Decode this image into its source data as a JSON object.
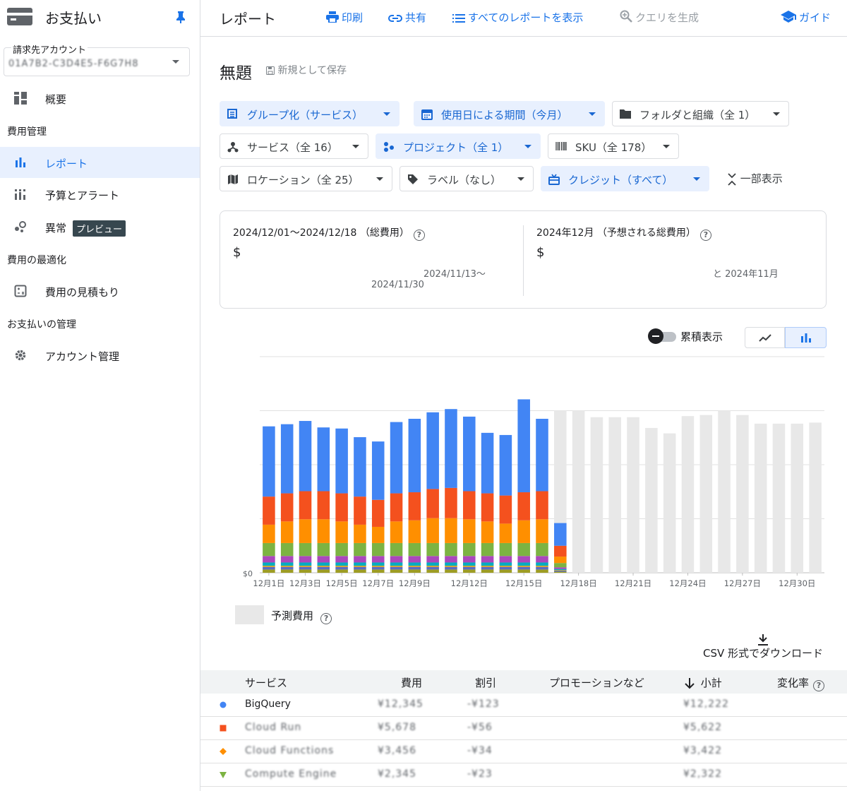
{
  "sidebar": {
    "app_title": "お支払い",
    "account_label": "請求先アカウント",
    "account_value": "01A7B2-C3D4E5-F6G7H8",
    "overview": "概要",
    "section_cost": "費用管理",
    "reports": "レポート",
    "budgets": "予算とアラート",
    "anomalies": "異常",
    "preview_badge": "プレビュー",
    "section_optimize": "費用の最適化",
    "estimate": "費用の見積もり",
    "section_manage": "お支払いの管理",
    "account_mgmt": "アカウント管理"
  },
  "topbar": {
    "title": "レポート",
    "print": "印刷",
    "share": "共有",
    "all_reports": "すべてのレポートを表示",
    "generate_query": "クエリを生成",
    "guide": "ガイド"
  },
  "report": {
    "title": "無題",
    "save_new": "新規として保存"
  },
  "filters": {
    "group": "グループ化（サービス）",
    "period": "使用日による期間（今月）",
    "folder": "フォルダと組織（全 1）",
    "service": "サービス（全 16）",
    "project": "プロジェクト（全 1）",
    "sku": "SKU（全 178）",
    "location": "ロケーション（全 25）",
    "label": "ラベル（なし）",
    "credit": "クレジット（すべて）",
    "collapse": "一部表示"
  },
  "summary": {
    "left_label": "2024/12/01〜2024/12/18 （総費用）",
    "left_value": "$",
    "left_compare_1": "2024/11/13〜",
    "left_compare_2": "2024/11/30",
    "right_label": "2024年12月 （予想される総費用）",
    "right_value": "$",
    "right_compare": "と 2024年11月"
  },
  "controls": {
    "cumulative": "累積表示",
    "forecast_legend": "予測費用",
    "csv": "CSV 形式でダウンロード"
  },
  "chart_data": {
    "type": "bar",
    "stacked": true,
    "x_ticks": [
      "12月1日",
      "12月3日",
      "12月5日",
      "12月7日",
      "12月9日",
      "12月12日",
      "12月15日",
      "12月18日",
      "12月21日",
      "12月24日",
      "12月27日",
      "12月30日"
    ],
    "y_tick_label": "$0",
    "ylim": [
      0,
      400
    ],
    "grid": true,
    "categories": [
      "12/1",
      "12/2",
      "12/3",
      "12/4",
      "12/5",
      "12/6",
      "12/7",
      "12/8",
      "12/9",
      "12/10",
      "12/11",
      "12/12",
      "12/13",
      "12/14",
      "12/15",
      "12/16",
      "12/17",
      "12/18",
      "12/19",
      "12/20",
      "12/21",
      "12/22",
      "12/23",
      "12/24",
      "12/25",
      "12/26",
      "12/27",
      "12/28",
      "12/29",
      "12/30",
      "12/31"
    ],
    "series": [
      {
        "color": "#9e9d24",
        "values": [
          6,
          6,
          6,
          6,
          6,
          6,
          6,
          6,
          6,
          6,
          6,
          6,
          6,
          6,
          6,
          6,
          2
        ]
      },
      {
        "color": "#5c6bc0",
        "values": [
          5,
          5,
          5,
          5,
          5,
          5,
          5,
          5,
          5,
          5,
          5,
          5,
          5,
          5,
          5,
          5,
          2
        ]
      },
      {
        "color": "#f9ab00",
        "values": [
          2,
          2,
          2,
          2,
          2,
          2,
          2,
          2,
          2,
          2,
          2,
          2,
          2,
          2,
          2,
          2,
          1
        ]
      },
      {
        "color": "#00acc1",
        "values": [
          6,
          6,
          6,
          6,
          6,
          6,
          6,
          6,
          6,
          6,
          6,
          6,
          6,
          6,
          6,
          6,
          2
        ]
      },
      {
        "color": "#ab47bc",
        "values": [
          12,
          12,
          12,
          12,
          12,
          12,
          12,
          12,
          12,
          12,
          12,
          12,
          12,
          12,
          12,
          12,
          3
        ]
      },
      {
        "color": "#7cb342",
        "values": [
          24,
          24,
          24,
          24,
          24,
          24,
          24,
          24,
          24,
          24,
          24,
          24,
          24,
          24,
          24,
          24,
          8
        ]
      },
      {
        "color": "#ff8f00",
        "values": [
          34,
          40,
          44,
          44,
          40,
          34,
          30,
          40,
          42,
          46,
          46,
          44,
          40,
          36,
          42,
          44,
          12
        ]
      },
      {
        "color": "#f4511e",
        "values": [
          52,
          52,
          52,
          52,
          52,
          52,
          50,
          52,
          52,
          54,
          56,
          52,
          52,
          52,
          52,
          52,
          20
        ]
      },
      {
        "color": "#4285f4",
        "values": [
          130,
          128,
          130,
          118,
          120,
          110,
          108,
          132,
          136,
          142,
          146,
          138,
          112,
          112,
          172,
          134,
          42
        ]
      }
    ],
    "forecast": {
      "color": "#e8e8e8",
      "start_index": 16,
      "values": [
        0,
        0,
        0,
        0,
        0,
        0,
        0,
        0,
        0,
        0,
        0,
        0,
        0,
        0,
        0,
        0,
        300,
        300,
        288,
        288,
        288,
        268,
        258,
        290,
        292,
        300,
        292,
        276,
        276,
        276,
        278
      ]
    }
  },
  "table": {
    "headers": {
      "service": "サービス",
      "cost": "費用",
      "discount": "割引",
      "promo": "プロモーションなど",
      "subtotal": "小計",
      "change": "変化率"
    },
    "rows": [
      {
        "marker": "circle",
        "color": "#4285f4",
        "service": "BigQuery",
        "cost": "¥12,345",
        "discount": "-¥123",
        "subtotal": "¥12,222"
      },
      {
        "marker": "square",
        "color": "#f4511e",
        "service": "Cloud Run",
        "cost": "¥5,678",
        "discount": "-¥56",
        "subtotal": "¥5,622"
      },
      {
        "marker": "diamond",
        "color": "#ff8f00",
        "service": "Cloud Functions",
        "cost": "¥3,456",
        "discount": "-¥34",
        "subtotal": "¥3,422"
      },
      {
        "marker": "triangle",
        "color": "#7cb342",
        "service": "Compute Engine",
        "cost": "¥2,345",
        "discount": "-¥23",
        "subtotal": "¥2,322"
      }
    ]
  }
}
